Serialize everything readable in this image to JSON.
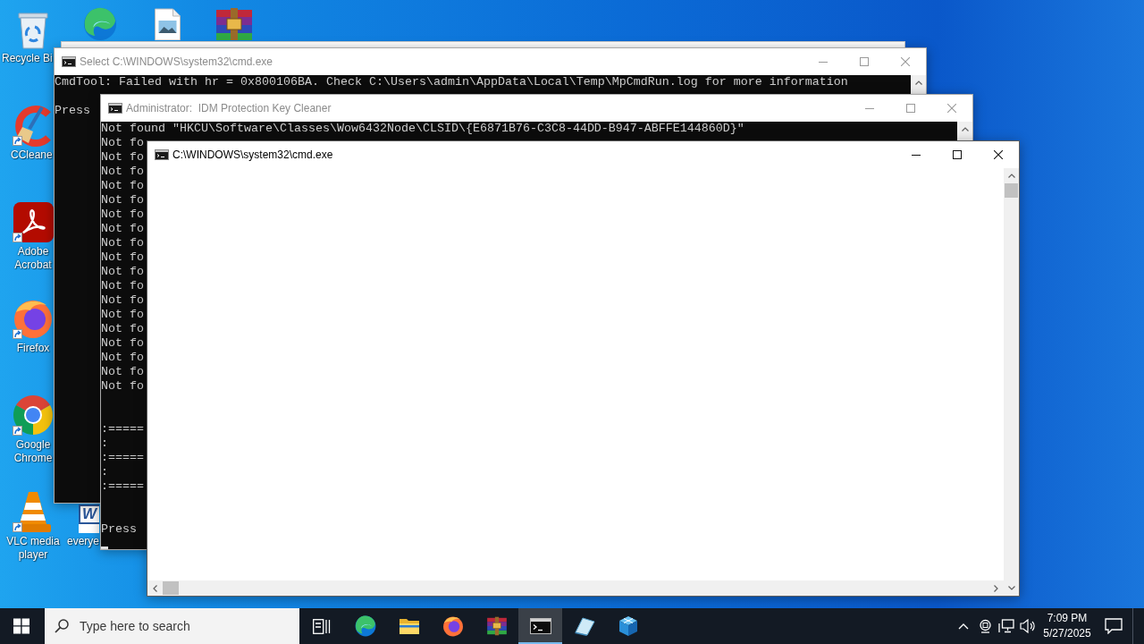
{
  "desktop_icons": [
    {
      "kind": "recycle-bin",
      "label": "Recycle Bi",
      "shortcut": false
    },
    {
      "kind": "edge",
      "shortcut": false
    },
    {
      "kind": "image-file",
      "shortcut": false
    },
    {
      "kind": "archive",
      "shortcut": false
    },
    {
      "kind": "ccleaner",
      "label": "CCleane",
      "shortcut": true
    },
    {
      "kind": "pdf",
      "label": "Adobe Acrobat",
      "shortcut": true
    },
    {
      "kind": "firefox",
      "label": "Firefox",
      "shortcut": true
    },
    {
      "kind": "chrome",
      "label": "Google Chrome",
      "shortcut": true
    },
    {
      "kind": "vlc",
      "label": "VLC media player",
      "shortcut": true
    },
    {
      "kind": "word-document",
      "icon_text": "W",
      "label": "everye",
      "shortcut": false
    }
  ],
  "windows": [
    {
      "kind": "frame"
    },
    {
      "kind": "console",
      "title": "Select C:\\WINDOWS\\system32\\cmd.exe",
      "active": false,
      "output": "CmdTool: Failed with hr = 0x800106BA. Check C:\\Users\\admin\\AppData\\Local\\Temp\\MpCmdRun.log for more information\n\nPress",
      "cursor": false
    },
    {
      "kind": "console",
      "title": "Administrator:  IDM Protection Key Cleaner",
      "active": false,
      "output": "Not found \"HKCU\\Software\\Classes\\Wow6432Node\\CLSID\\{E6871B76-C3C8-44DD-B947-ABFFE144860D}\"\nNot fo\nNot fo\nNot fo\nNot fo\nNot fo\nNot fo\nNot fo\nNot fo\nNot fo\nNot fo\nNot fo\nNot fo\nNot fo\nNot fo\nNot fo\nNot fo\nNot fo\nNot fo\n\n\n:=====\n:\n:=====\n:\n:=====\n\n\nPress",
      "cursor": true
    },
    {
      "kind": "blank",
      "title": "C:\\WINDOWS\\system32\\cmd.exe",
      "active": true
    }
  ],
  "taskbar": {
    "search": {
      "placeholder": "Type here to search"
    },
    "apps": [
      {
        "kind": "task-view",
        "selected": false
      },
      {
        "kind": "edge",
        "selected": false
      },
      {
        "kind": "folder",
        "selected": false
      },
      {
        "kind": "firefox",
        "selected": false
      },
      {
        "kind": "archive",
        "selected": false
      },
      {
        "kind": "terminal",
        "selected": true
      },
      {
        "kind": "notes",
        "selected": false
      },
      {
        "kind": "cube",
        "selected": false
      }
    ],
    "clock": {
      "time": "7:09 PM",
      "date": "5/27/2025"
    }
  }
}
